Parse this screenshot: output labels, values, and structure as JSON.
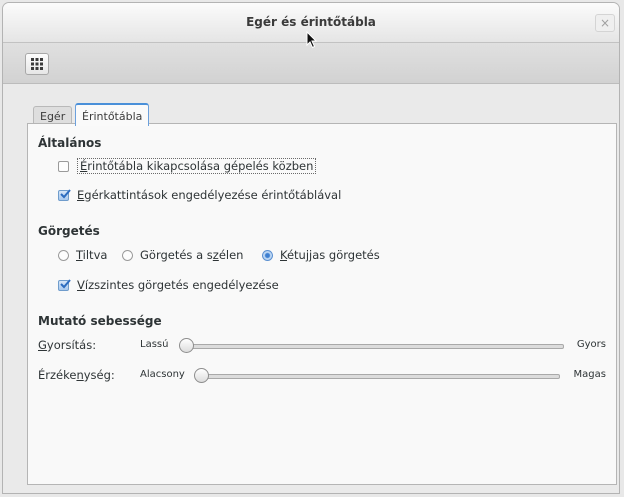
{
  "window": {
    "title": "Egér és érintőtábla",
    "close_glyph": "×"
  },
  "toolbar": {
    "overview_icon": "grid-icon"
  },
  "tabs": [
    {
      "label": "Egér",
      "active": false
    },
    {
      "label": "Érintőtábla",
      "active": true
    }
  ],
  "general": {
    "heading": "Általános",
    "disable_while_typing": {
      "label_mnemonic": "É",
      "label_rest": "rintőtábla kikapcsolása gépelés közben",
      "checked": false
    },
    "tap_to_click": {
      "label_mnemonic": "E",
      "label_rest": "gérkattintások engedélyezése érintőtáblával",
      "checked": true
    }
  },
  "scrolling": {
    "heading": "Görgetés",
    "options": [
      {
        "label_mnemonic": "T",
        "label_rest": "iltva",
        "selected": false
      },
      {
        "label_pre": "Görgetés a s",
        "label_mnemonic": "z",
        "label_rest": "élen",
        "selected": false
      },
      {
        "label_mnemonic": "K",
        "label_rest": "étujjas görgetés",
        "selected": true
      }
    ],
    "horizontal": {
      "label_mnemonic": "V",
      "label_rest": "ízszintes görgetés engedélyezése",
      "checked": true
    }
  },
  "pointer_speed": {
    "heading": "Mutató sebessége",
    "acceleration": {
      "label_mnemonic": "G",
      "label_rest": "yorsítás:",
      "min_label": "Lassú",
      "max_label": "Gyors",
      "value": 0
    },
    "sensitivity": {
      "label_pre": "Érzéke",
      "label_mnemonic": "n",
      "label_rest": "ység:",
      "min_label": "Alacsony",
      "max_label": "Magas",
      "value": 0
    }
  },
  "colors": {
    "accent": "#4a90d9",
    "check": "#3d7fd1"
  }
}
